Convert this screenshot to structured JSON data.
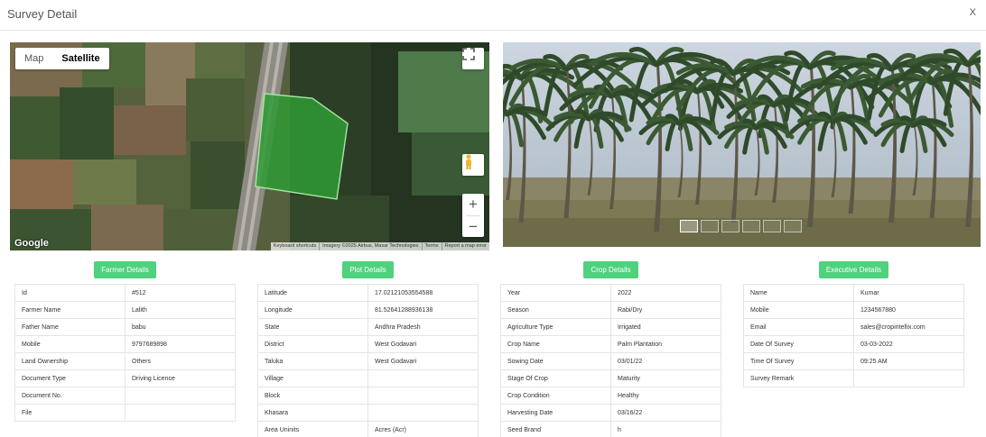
{
  "modal": {
    "title": "Survey Detail",
    "close_label": "X"
  },
  "map": {
    "type_map": "Map",
    "type_satellite": "Satellite",
    "logo": "Google",
    "attribution": {
      "shortcuts": "Keyboard shortcuts",
      "imagery": "Imagery ©2025 Airbus, Maxar Technologies",
      "terms": "Terms",
      "report": "Report a map error"
    },
    "zoom_in": "+",
    "zoom_out": "−",
    "fullscreen_icon": "fullscreen-icon",
    "pegman_icon": "pegman-icon"
  },
  "photo": {
    "thumb_count": 6,
    "active_thumb": 0
  },
  "colors": {
    "accent": "#4fd17e",
    "field": "#2f9a35"
  },
  "sections": [
    {
      "button": "Farmer Details",
      "rows": [
        {
          "k": "Id",
          "v": "#512"
        },
        {
          "k": "Farmer Name",
          "v": "Lalith"
        },
        {
          "k": "Father Name",
          "v": "babu"
        },
        {
          "k": "Mobile",
          "v": "9797689898"
        },
        {
          "k": "Land Ownership",
          "v": "Others"
        },
        {
          "k": "Document Type",
          "v": "Driving Licence"
        },
        {
          "k": "Document No.",
          "v": ""
        },
        {
          "k": "File",
          "v": ""
        }
      ]
    },
    {
      "button": "Plot Details",
      "rows": [
        {
          "k": "Latitude",
          "v": "17.02121053554588"
        },
        {
          "k": "Longitude",
          "v": "81.52641288936138"
        },
        {
          "k": "State",
          "v": "Andhra Pradesh"
        },
        {
          "k": "District",
          "v": "West Godavari"
        },
        {
          "k": "Taluka",
          "v": "West Godavari"
        },
        {
          "k": "Village",
          "v": ""
        },
        {
          "k": "Block",
          "v": ""
        },
        {
          "k": "Khasara",
          "v": ""
        },
        {
          "k": "Area Uninits",
          "v": "Acres (Acr)"
        }
      ]
    },
    {
      "button": "Crop Details",
      "rows": [
        {
          "k": "Year",
          "v": "2022"
        },
        {
          "k": "Season",
          "v": "Rabi/Dry"
        },
        {
          "k": "Agriculture Type",
          "v": "Irrigated"
        },
        {
          "k": "Crop Name",
          "v": "Palm Plantation"
        },
        {
          "k": "Sowing Date",
          "v": "03/01/22"
        },
        {
          "k": "Stage Of Crop",
          "v": "Maturity"
        },
        {
          "k": "Crop Condition",
          "v": "Healthy"
        },
        {
          "k": "Harvesting Date",
          "v": "03/16/22"
        },
        {
          "k": "Seed Brand",
          "v": "h"
        }
      ]
    },
    {
      "button": "Executive Details",
      "rows": [
        {
          "k": "Name",
          "v": "Kumar"
        },
        {
          "k": "Mobile",
          "v": "1234567880"
        },
        {
          "k": "Email",
          "v": "sales@cropintellix.com"
        },
        {
          "k": "Date Of Survey",
          "v": "03-03-2022"
        },
        {
          "k": "Time Of Survey",
          "v": "09:25 AM"
        },
        {
          "k": "Survey Remark",
          "v": ""
        }
      ]
    }
  ]
}
